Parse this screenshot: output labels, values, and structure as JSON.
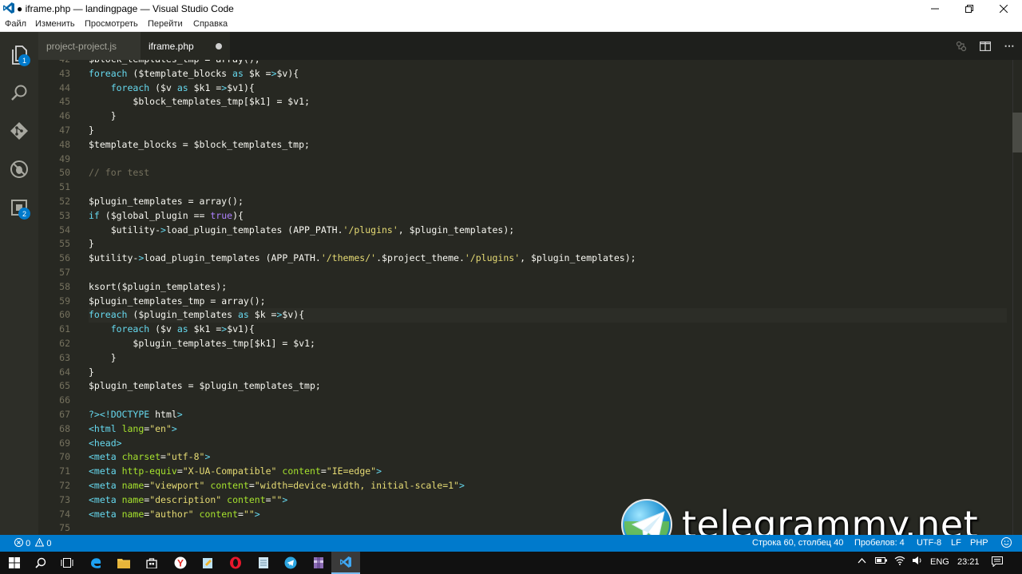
{
  "window": {
    "title": "● iframe.php — landingpage — Visual Studio Code"
  },
  "menu": [
    "Файл",
    "Изменить",
    "Просмотреть",
    "Перейти",
    "Справка"
  ],
  "activity_bar": {
    "explorer_badge": "1",
    "extensions_badge": "2"
  },
  "tabs": [
    {
      "label": "project-project.js",
      "active": false
    },
    {
      "label": "iframe.php",
      "active": true,
      "modified": true
    }
  ],
  "editor": {
    "lines": [
      {
        "n": "42",
        "text": "$block_templates_tmp = array();"
      },
      {
        "n": "43",
        "text": "foreach ($template_blocks as $k =>$v){"
      },
      {
        "n": "44",
        "text": "    foreach ($v as $k1 =>$v1){"
      },
      {
        "n": "45",
        "text": "        $block_templates_tmp[$k1] = $v1;"
      },
      {
        "n": "46",
        "text": "    }"
      },
      {
        "n": "47",
        "text": "}"
      },
      {
        "n": "48",
        "text": "$template_blocks = $block_templates_tmp;"
      },
      {
        "n": "49",
        "text": ""
      },
      {
        "n": "50",
        "text": "// for test"
      },
      {
        "n": "51",
        "text": ""
      },
      {
        "n": "52",
        "text": "$plugin_templates = array();"
      },
      {
        "n": "53",
        "text": "if ($global_plugin == true){"
      },
      {
        "n": "54",
        "text": "    $utility->load_plugin_templates (APP_PATH.'/plugins', $plugin_templates);"
      },
      {
        "n": "55",
        "text": "}"
      },
      {
        "n": "56",
        "text": "$utility->load_plugin_templates (APP_PATH.'/themes/'.$project_theme.'/plugins', $plugin_templates);"
      },
      {
        "n": "57",
        "text": ""
      },
      {
        "n": "58",
        "text": "ksort($plugin_templates);"
      },
      {
        "n": "59",
        "text": "$plugin_templates_tmp = array();"
      },
      {
        "n": "60",
        "text": "foreach ($plugin_templates as $k =>$v){"
      },
      {
        "n": "61",
        "text": "    foreach ($v as $k1 =>$v1){"
      },
      {
        "n": "62",
        "text": "        $plugin_templates_tmp[$k1] = $v1;"
      },
      {
        "n": "63",
        "text": "    }"
      },
      {
        "n": "64",
        "text": "}"
      },
      {
        "n": "65",
        "text": "$plugin_templates = $plugin_templates_tmp;"
      },
      {
        "n": "66",
        "text": ""
      },
      {
        "n": "67",
        "text": "?><!DOCTYPE html>"
      },
      {
        "n": "68",
        "text": "<html lang=\"en\">"
      },
      {
        "n": "69",
        "text": "<head>"
      },
      {
        "n": "70",
        "text": "<meta charset=\"utf-8\">"
      },
      {
        "n": "71",
        "text": "<meta http-equiv=\"X-UA-Compatible\" content=\"IE=edge\">"
      },
      {
        "n": "72",
        "text": "<meta name=\"viewport\" content=\"width=device-width, initial-scale=1\">"
      },
      {
        "n": "73",
        "text": "<meta name=\"description\" content=\"\">"
      },
      {
        "n": "74",
        "text": "<meta name=\"author\" content=\"\">"
      },
      {
        "n": "75",
        "text": ""
      }
    ]
  },
  "watermark": {
    "text": "telegrammy.net"
  },
  "status": {
    "errors": "0",
    "warnings": "0",
    "position": "Строка 60, столбец 40",
    "indent": "Пробелов: 4",
    "encoding": "UTF-8",
    "eol": "LF",
    "language": "PHP"
  },
  "taskbar": {
    "lang": "ENG",
    "time": "23:21"
  }
}
